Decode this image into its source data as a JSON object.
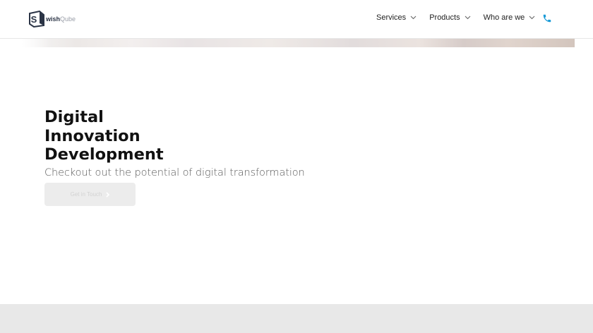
{
  "brand": {
    "logo_letter": "S",
    "name_bold": "wish",
    "name_light": "Qube"
  },
  "nav": {
    "items": [
      {
        "label": "Services"
      },
      {
        "label": "Products"
      },
      {
        "label": "Who are we"
      }
    ]
  },
  "hero": {
    "headline_line1": "Digital",
    "headline_line2": "Innovation",
    "headline_line3": "Development",
    "subheading": "Checkout out the potential of digital transformation",
    "cta_label": "Get in Touch"
  },
  "colors": {
    "accent": "#1a9bd7",
    "text_dark": "#111111",
    "cta_bg": "#ececec",
    "footer_bg": "#e8e8e8"
  },
  "icons": {
    "nav_chevron": "chevron-down-icon",
    "contact": "phone-icon",
    "cta": "chevron-right-icon"
  }
}
